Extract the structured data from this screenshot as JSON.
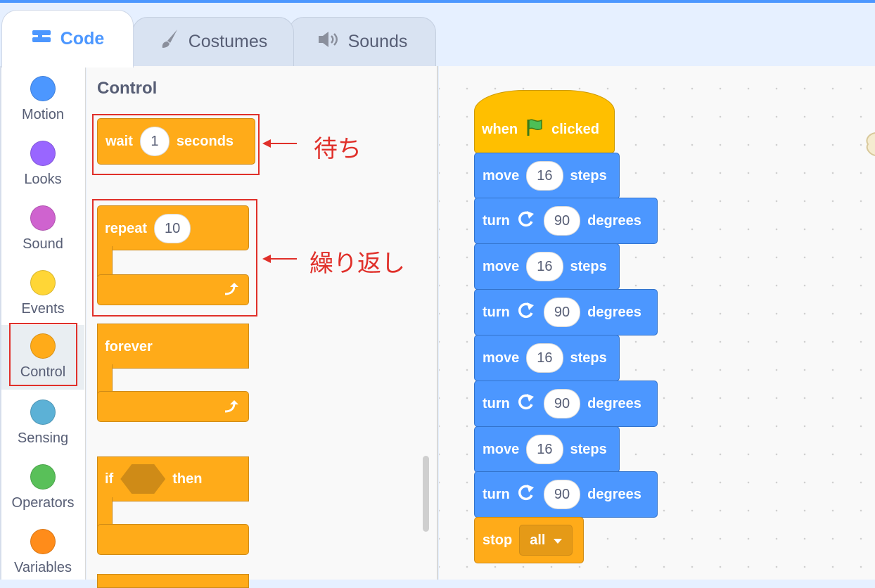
{
  "tabs": [
    {
      "label": "Code",
      "icon": "code-icon"
    },
    {
      "label": "Costumes",
      "icon": "brush-icon"
    },
    {
      "label": "Sounds",
      "icon": "speaker-icon"
    }
  ],
  "categories": [
    {
      "label": "Motion",
      "color": "#4c97ff"
    },
    {
      "label": "Looks",
      "color": "#9966ff"
    },
    {
      "label": "Sound",
      "color": "#cf63cf"
    },
    {
      "label": "Events",
      "color": "#ffd636"
    },
    {
      "label": "Control",
      "color": "#ffab19"
    },
    {
      "label": "Sensing",
      "color": "#5cb1d6"
    },
    {
      "label": "Operators",
      "color": "#59c059"
    },
    {
      "label": "Variables",
      "color": "#ff8c1a"
    }
  ],
  "palette": {
    "title": "Control",
    "wait": {
      "label": "wait",
      "value": "1",
      "unit": "seconds"
    },
    "repeat": {
      "label": "repeat",
      "value": "10"
    },
    "forever": {
      "label": "forever"
    },
    "if_then": {
      "if": "if",
      "then": "then"
    }
  },
  "annotations": {
    "wait_note": "待ち",
    "repeat_note": "繰り返し"
  },
  "script": {
    "hat": {
      "when": "when",
      "clicked": "clicked"
    },
    "steps": [
      {
        "verb": "move",
        "value": "16",
        "unit": "steps"
      },
      {
        "verb": "turn",
        "value": "90",
        "unit": "degrees"
      },
      {
        "verb": "move",
        "value": "16",
        "unit": "steps"
      },
      {
        "verb": "turn",
        "value": "90",
        "unit": "degrees"
      },
      {
        "verb": "move",
        "value": "16",
        "unit": "steps"
      },
      {
        "verb": "turn",
        "value": "90",
        "unit": "degrees"
      },
      {
        "verb": "move",
        "value": "16",
        "unit": "steps"
      },
      {
        "verb": "turn",
        "value": "90",
        "unit": "degrees"
      }
    ],
    "stop": {
      "label": "stop",
      "option": "all"
    }
  },
  "colors": {
    "control": "#ffab19",
    "motion": "#4c97ff",
    "highlight": "#e0302a",
    "tab_active": "#4c97ff"
  }
}
